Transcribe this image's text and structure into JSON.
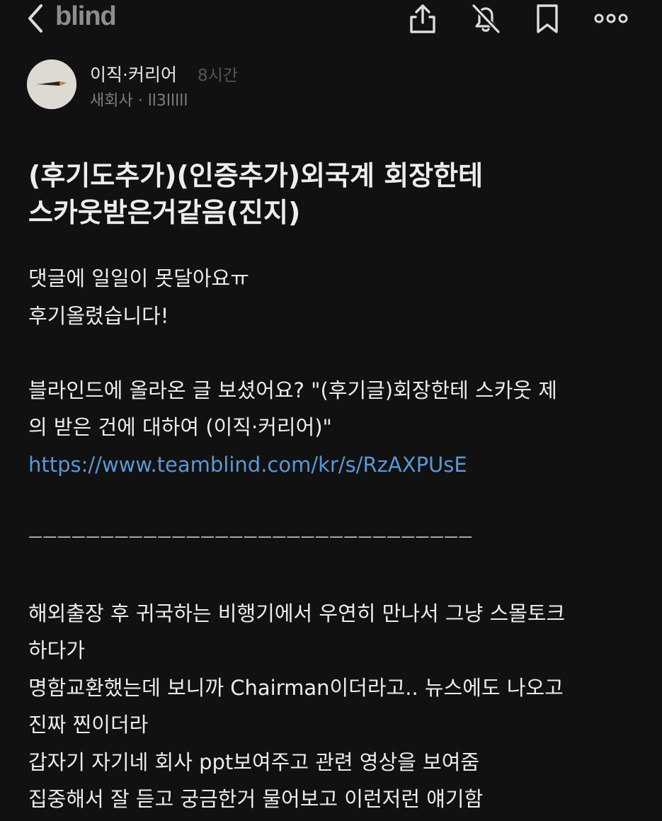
{
  "app": {
    "logo": "blind"
  },
  "toolbar": {
    "icons": [
      "back-chevron-icon",
      "share-icon",
      "notification-off-icon",
      "bookmark-icon",
      "more-icon"
    ]
  },
  "author": {
    "channel": "이직·커리어",
    "time": "8시간",
    "company": "새회사 · ll3lllll"
  },
  "post": {
    "title_lines": [
      "(후기도추가)(인증추가)외국계 회장한테",
      "스카웃받은거같음(진지)"
    ],
    "body_lines": [
      "댓글에 일일이 못달아요ㅠ",
      "후기올렸습니다!",
      "",
      "블라인드에 올라온 글 보셨어요? \"(후기글)회장한테 스카웃 제",
      "의 받은 건에 대하여 (이직·커리어)\"",
      "https://www.teamblind.com/kr/s/RzAXPUsE",
      "",
      "ㅡㅡㅡㅡㅡㅡㅡㅡㅡㅡㅡㅡㅡㅡㅡㅡㅡㅡㅡㅡㅡㅡㅡㅡㅡㅡㅡㅡㅡㅡㅡ",
      "",
      "해외출장 후 귀국하는 비행기에서 우연히 만나서 그냥 스몰토크",
      "하다가",
      "명함교환했는데 보니까 Chairman이더라고.. 뉴스에도 나오고",
      "진짜 찐이더라",
      "갑자기 자기네 회사 ppt보여주고 관련 영상을 보여줌",
      "집중해서 잘 듣고 궁금한거 물어보고 이런저런 얘기함"
    ]
  },
  "colors": {
    "background": "#111111",
    "text": "#ececec",
    "link": "#5b97d4",
    "muted": "#7e7e7e"
  }
}
